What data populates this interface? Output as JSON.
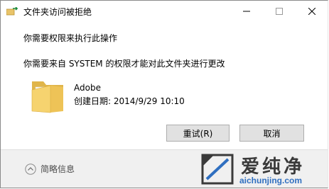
{
  "window": {
    "title": "文件夹访问被拒绝",
    "minimize_glyph": "—",
    "maximize_glyph": "☐",
    "close_glyph": "✕"
  },
  "message": {
    "primary": "你需要权限来执行此操作",
    "secondary": "你需要来自 SYSTEM 的权限才能对此文件夹进行更改"
  },
  "file": {
    "icon": "folder-icon",
    "name": "Adobe",
    "created": "创建日期: 2014/9/29 10:10"
  },
  "buttons": {
    "retry": "重试(R)",
    "cancel": "取消"
  },
  "footer": {
    "details_label": "简略信息",
    "details_icon": "chevron-up-icon"
  },
  "watermark": {
    "text": "爱纯净",
    "url": "aichunjing.com"
  },
  "colors": {
    "button_bg": "#e1e1e1",
    "footer_bg": "#f0f0f0",
    "folder": "#f3c95a",
    "watermark_url": "#2f6fc0"
  }
}
